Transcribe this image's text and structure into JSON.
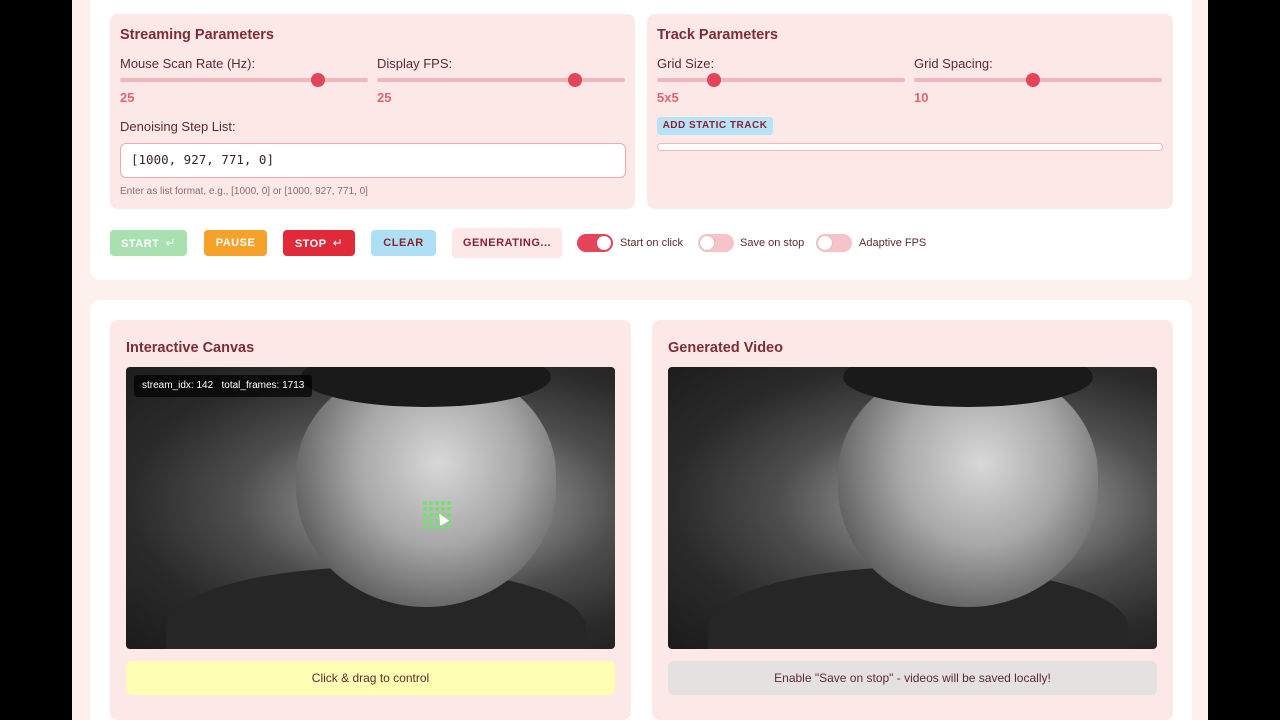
{
  "streaming": {
    "title": "Streaming Parameters",
    "mouse_scan_label": "Mouse Scan Rate (Hz):",
    "mouse_scan_value": "25",
    "mouse_scan_level": 0.8,
    "display_fps_label": "Display FPS:",
    "display_fps_value": "25",
    "display_fps_level": 0.8,
    "denoise_label": "Denoising Step List:",
    "denoise_value": "[1000, 927, 771, 0]",
    "denoise_hint": "Enter as list format, e.g., [1000, 0] or [1000, 927, 771, 0]"
  },
  "track": {
    "title": "Track Parameters",
    "grid_size_label": "Grid Size:",
    "grid_size_value": "5x5",
    "grid_size_level": 0.23,
    "grid_spacing_label": "Grid Spacing:",
    "grid_spacing_value": "10",
    "grid_spacing_level": 0.48,
    "add_static_track": "ADD STATIC TRACK"
  },
  "controls": {
    "start": "START",
    "pause": "PAUSE",
    "stop": "STOP",
    "clear": "CLEAR",
    "generating": "GENERATING...",
    "enter_glyph": "↵",
    "start_on_click": "Start on click",
    "start_on_click_on": true,
    "save_on_stop": "Save on stop",
    "save_on_stop_on": false,
    "adaptive_fps": "Adaptive FPS",
    "adaptive_fps_on": false
  },
  "canvas": {
    "title": "Interactive Canvas",
    "stream_idx": "stream_idx: 142",
    "total_frames": "total_frames: 1713",
    "hint": "Click & drag to control"
  },
  "video": {
    "title": "Generated Video",
    "note": "Enable \"Save on stop\" - videos will be saved locally!"
  },
  "colors": {
    "accent": "#e5455a",
    "panel": "#fde8e8",
    "start_btn": "#a8e0b0",
    "pause_btn": "#f5a12a",
    "stop_btn": "#e02a3a",
    "clear_btn": "#aee0f5",
    "track_dot": "#6fe36a"
  }
}
